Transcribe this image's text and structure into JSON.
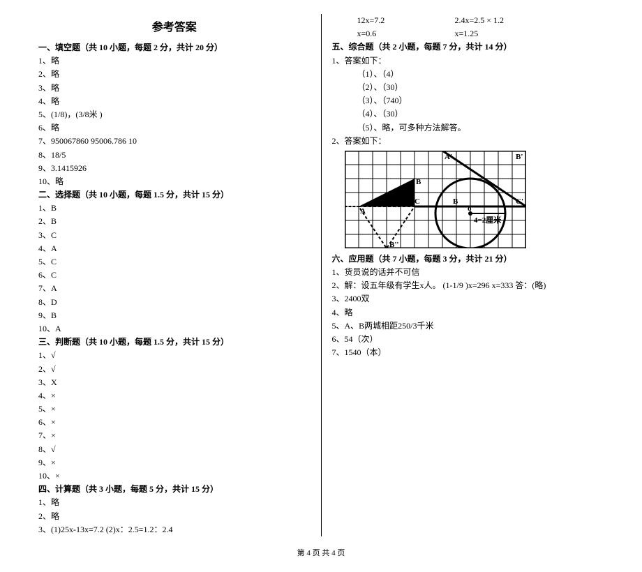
{
  "title": "参考答案",
  "sec1_header": "一、填空题（共 10 小题，每题 2 分，共计 20 分）",
  "sec1_items": [
    "1、略",
    "2、略",
    "3、略",
    "4、略",
    "5、(1/8)，(3/8米 )",
    "6、略",
    "7、950067860    95006.786    10",
    "8、18/5",
    "9、3.1415926",
    "10、略"
  ],
  "sec2_header": "二、选择题（共 10 小题，每题 1.5 分，共计 15 分）",
  "sec2_items": [
    "1、B",
    "2、B",
    "3、C",
    "4、A",
    "5、C",
    "6、C",
    "7、A",
    "8、D",
    "9、B",
    "10、A"
  ],
  "sec3_header": "三、判断题（共 10 小题，每题 1.5 分，共计 15 分）",
  "sec3_items": [
    "1、√",
    "2、√",
    "3、X",
    "4、×",
    "5、×",
    "6、×",
    "7、×",
    "8、√",
    "9、×",
    "10、×"
  ],
  "sec4_header": "四、计算题（共 3 小题，每题 5 分，共计 15 分）",
  "sec4_items": [
    "1、略",
    "2、略",
    "3、(1)25x-13x=7.2          (2)x：2.5=1.2：2.4"
  ],
  "sec4_calc1": "12x=7.2",
  "sec4_calc2": "2.4x=2.5 × 1.2",
  "sec4_calc3": "x=0.6",
  "sec4_calc4": "x=1.25",
  "sec5_header": "五、综合题（共 2 小题，每题 7 分，共计 14 分）",
  "sec5_1_head": "1、答案如下：",
  "sec5_1_items": [
    "（1）、（4）",
    "（2）、（30）",
    "（3）、（740）",
    "（4）、（30）",
    "（5）、略，可多种方法解答。"
  ],
  "sec5_2_head": "2、答案如下：",
  "diagram_label_grid": "4=2厘米",
  "sec6_header": "六、应用题（共 7 小题，每题 3 分，共计 21 分）",
  "sec6_items": [
    "1、货员说的话并不可信",
    "2、解：设五年级有学生x人。 (1-1/9 )x=296 x=333 答：(略)",
    "3、2400双",
    "4、略",
    "5、A、B两城相距250/3千米",
    "6、54（次）",
    "7、1540（本）"
  ],
  "footer": "第 4 页 共 4 页"
}
